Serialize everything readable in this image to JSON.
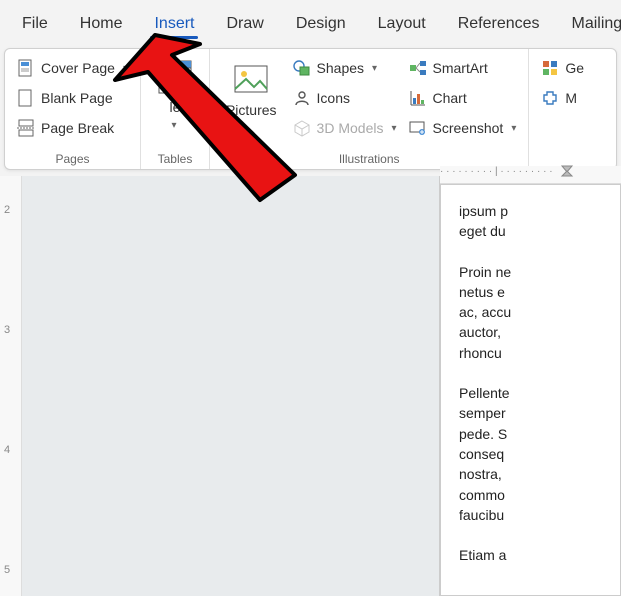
{
  "tabs": {
    "file": "File",
    "home": "Home",
    "insert": "Insert",
    "draw": "Draw",
    "design": "Design",
    "layout": "Layout",
    "references": "References",
    "mailings": "Mailings"
  },
  "ribbon": {
    "pages": {
      "label": "Pages",
      "cover_page": "Cover Page",
      "blank_page": "Blank Page",
      "page_break": "Page Break"
    },
    "tables": {
      "label": "Tables",
      "table": "le"
    },
    "illustrations": {
      "label": "Illustrations",
      "pictures": "Pictures",
      "shapes": "Shapes",
      "icons": "Icons",
      "models3d": "3D Models",
      "smartart": "SmartArt",
      "chart": "Chart",
      "screenshot": "Screenshot"
    },
    "right": {
      "get": "Ge",
      "my": "M"
    }
  },
  "document": {
    "p1": "ipsum p",
    "p2": "eget du",
    "p3": "Proin ne",
    "p4": "netus e",
    "p5": "ac, accu",
    "p6": "auctor,",
    "p7": "rhoncu",
    "p8": "Pellente",
    "p9": "semper",
    "p10": "pede. S",
    "p11": "conseq",
    "p12": "nostra,",
    "p13": "commo",
    "p14": "faucibu",
    "p15": "Etiam a"
  },
  "ruler": {
    "m2": "2",
    "m3": "3",
    "m4": "4",
    "m5": "5"
  }
}
